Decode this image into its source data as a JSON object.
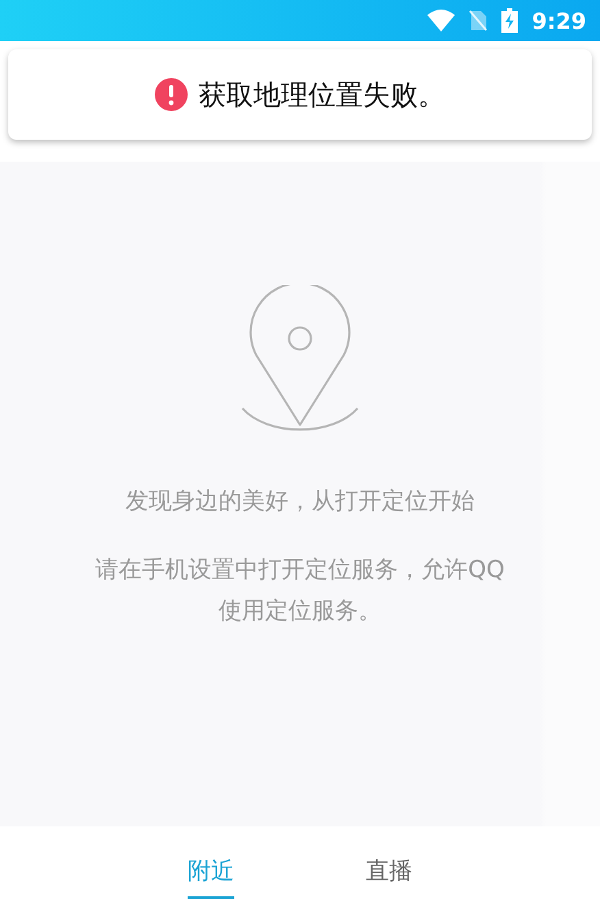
{
  "status_bar": {
    "time": "9:29"
  },
  "toast": {
    "message": "获取地理位置失败。"
  },
  "empty_state": {
    "headline": "发现身边的美好，从打开定位开始",
    "hint": "请在手机设置中打开定位服务，允许QQ使用定位服务。"
  },
  "tabs": [
    {
      "label": "附近",
      "selected": true
    },
    {
      "label": "直播",
      "selected": false
    }
  ]
}
